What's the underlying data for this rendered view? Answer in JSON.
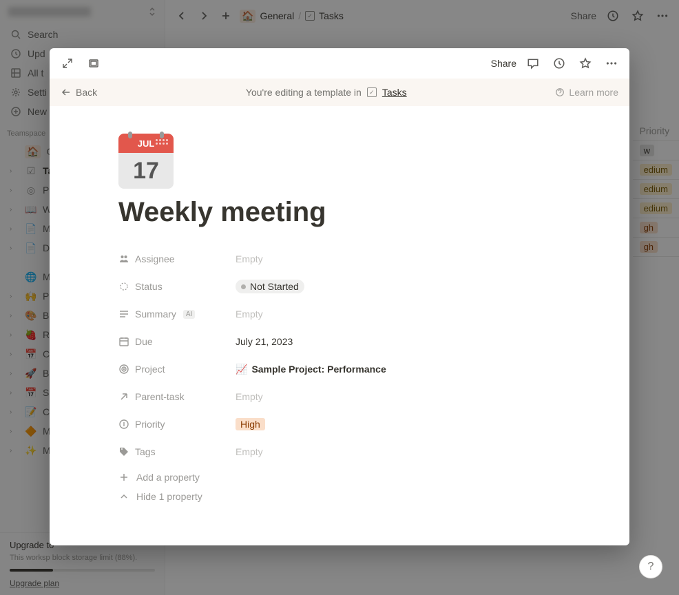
{
  "sidebar": {
    "nav": {
      "search": "Search",
      "updates": "Upd",
      "all": "All t",
      "settings": "Setti",
      "new": "New"
    },
    "section1_label": "Teamspace",
    "section1": [
      {
        "icon": "🏠",
        "label": "Gene",
        "active": true,
        "caret": false,
        "home_box": true
      },
      {
        "icon": "☑",
        "label": "Tas",
        "active": true,
        "caret": true,
        "bold": true
      },
      {
        "icon": "◎",
        "label": "Pro",
        "caret": true
      },
      {
        "icon": "📖",
        "label": "Wi",
        "caret": true
      },
      {
        "icon": "📄",
        "label": "Me",
        "caret": true
      },
      {
        "icon": "📄",
        "label": "Do",
        "caret": true
      }
    ],
    "section2": [
      {
        "icon": "🌐",
        "label": "Marl",
        "caret": false,
        "circle": true
      },
      {
        "icon": "🙌",
        "label": "Pre",
        "caret": true
      },
      {
        "icon": "🎨",
        "label": "Bra",
        "caret": true
      },
      {
        "icon": "🍓",
        "label": "Re",
        "caret": true
      },
      {
        "icon": "📅",
        "label": "Co",
        "caret": true
      },
      {
        "icon": "🚀",
        "label": "Blo",
        "caret": true
      },
      {
        "icon": "📅",
        "label": "So",
        "caret": true
      },
      {
        "icon": "📝",
        "label": "Ca",
        "caret": true
      },
      {
        "icon": "🔶",
        "label": "Mo",
        "caret": true
      },
      {
        "icon": "✨",
        "label": "Me",
        "caret": true
      }
    ],
    "upgrade": {
      "title": "Upgrade to",
      "sub": "This worksp\nblock storage limit (88%).",
      "link": "Upgrade plan"
    }
  },
  "topbar": {
    "crumb_home": "General",
    "crumb_page": "Tasks",
    "share": "Share"
  },
  "bg_table": {
    "header": "Priority",
    "rows": [
      "w",
      "edium",
      "edium",
      "edium",
      "gh",
      "gh"
    ]
  },
  "modal": {
    "top_share": "Share",
    "banner": {
      "back": "Back",
      "text": "You're editing a template in",
      "link": "Tasks",
      "learn": "Learn more"
    },
    "icon": {
      "month": "JUL",
      "day": "17"
    },
    "title": "Weekly meeting",
    "props": [
      {
        "icon": "people",
        "label": "Assignee",
        "value": "Empty",
        "type": "empty"
      },
      {
        "icon": "status",
        "label": "Status",
        "value": "Not Started",
        "type": "status"
      },
      {
        "icon": "lines",
        "label": "Summary",
        "badge": "AI",
        "value": "Empty",
        "type": "empty"
      },
      {
        "icon": "calendar",
        "label": "Due",
        "value": "July 21, 2023",
        "type": "text"
      },
      {
        "icon": "target",
        "label": "Project",
        "value": "Sample Project: Performance",
        "type": "project",
        "emoji": "📈"
      },
      {
        "icon": "arrow-up",
        "label": "Parent-task",
        "value": "Empty",
        "type": "empty"
      },
      {
        "icon": "priority",
        "label": "Priority",
        "value": "High",
        "type": "priority"
      },
      {
        "icon": "tag",
        "label": "Tags",
        "value": "Empty",
        "type": "empty"
      }
    ],
    "add_prop": "Add a property",
    "hide_prop": "Hide 1 property"
  }
}
